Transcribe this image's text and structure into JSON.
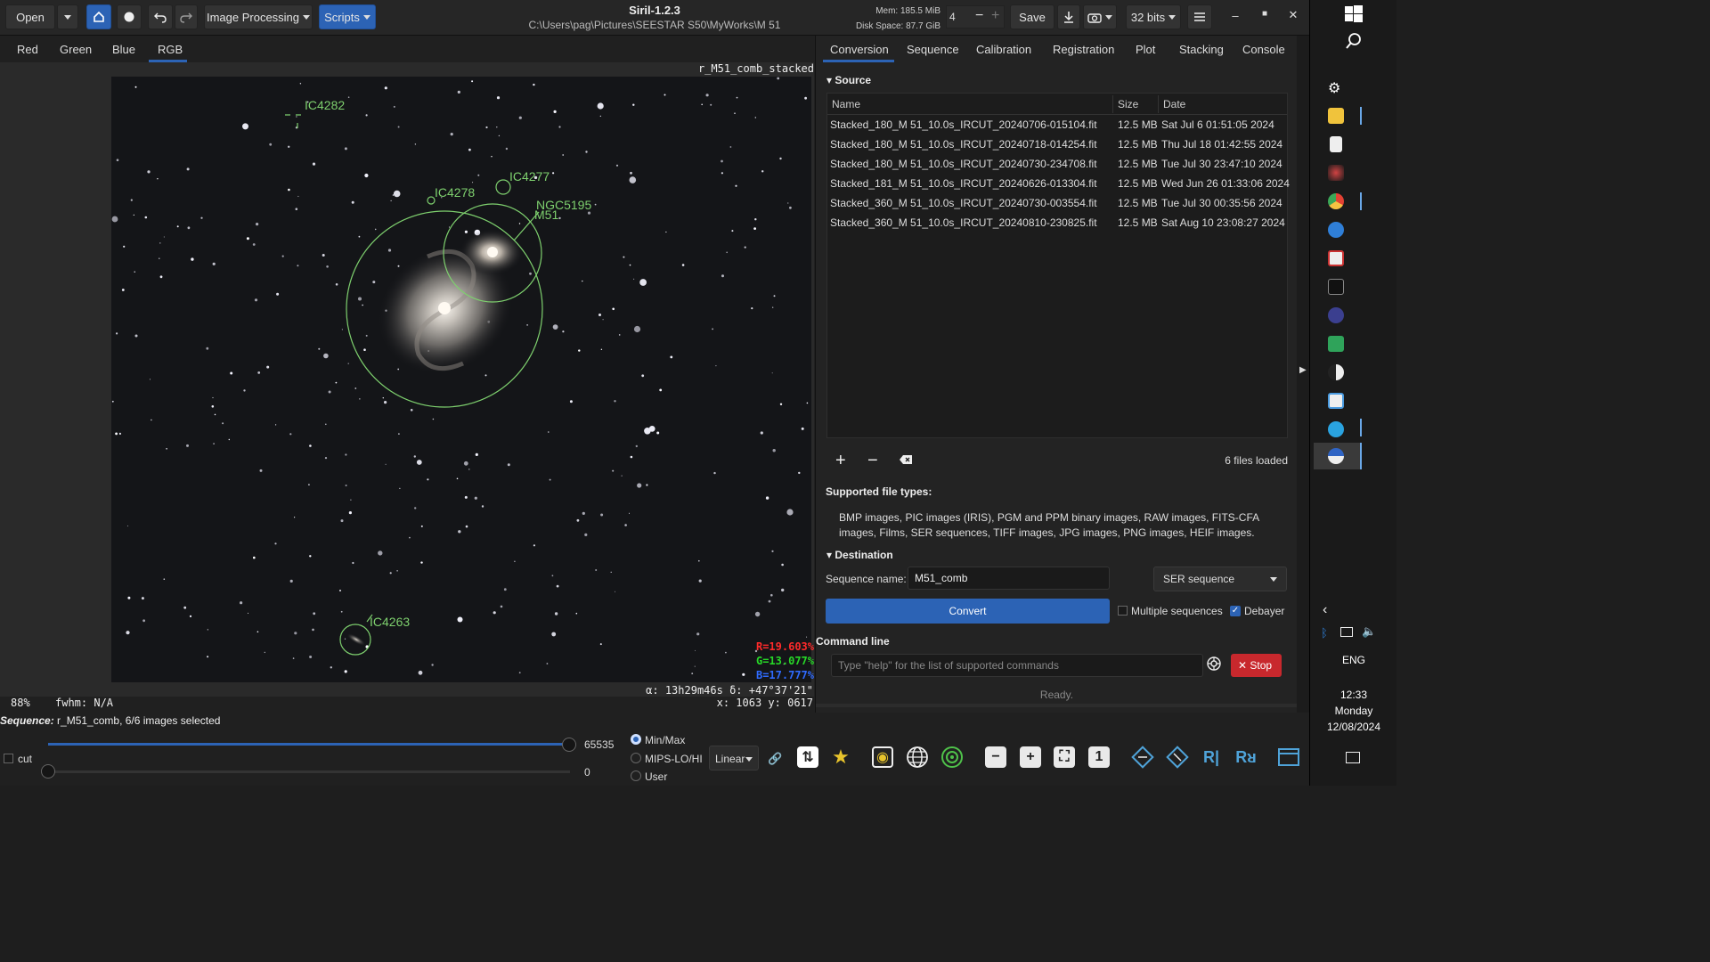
{
  "window": {
    "app_title": "Siril-1.2.3",
    "path": "C:\\Users\\pag\\Pictures\\SEESTAR S50\\MyWorks\\M 51",
    "mem": "Mem: 185.5 MiB",
    "disk": "Disk Space: 87.7 GiB",
    "threads": "4",
    "open_label": "Open",
    "image_processing_label": "Image Processing",
    "scripts_label": "Scripts",
    "save_label": "Save",
    "bits_label": "32 bits"
  },
  "view_tabs": [
    "Red",
    "Green",
    "Blue",
    "RGB"
  ],
  "active_view_tab": "RGB",
  "image": {
    "name": "r_M51_comb_stacked",
    "annotations": [
      "IC4282",
      "IC4277",
      "IC4278",
      "NGC5195",
      "M51",
      "IC4263"
    ],
    "r_value": "R=19.603%",
    "g_value": "G=13.077%",
    "b_value": "B=17.777%",
    "zoom": "88%",
    "fwhm": "fwhm: N/A",
    "coords": "α: 13h29m46s δ: +47°37'21\"",
    "xy": "x: 1063 y: 0617"
  },
  "right_tabs": [
    "Conversion",
    "Sequence",
    "Calibration",
    "Registration",
    "Plot",
    "Stacking",
    "Console"
  ],
  "active_right_tab": "Conversion",
  "source": {
    "header": "Source",
    "columns": {
      "name": "Name",
      "size": "Size",
      "date": "Date"
    },
    "files": [
      {
        "name": "Stacked_180_M 51_10.0s_IRCUT_20240706-015104.fit",
        "size": "12.5 MB",
        "date": "Sat Jul  6 01:51:05 2024"
      },
      {
        "name": "Stacked_180_M 51_10.0s_IRCUT_20240718-014254.fit",
        "size": "12.5 MB",
        "date": "Thu Jul 18 01:42:55 2024"
      },
      {
        "name": "Stacked_180_M 51_10.0s_IRCUT_20240730-234708.fit",
        "size": "12.5 MB",
        "date": "Tue Jul 30 23:47:10 2024"
      },
      {
        "name": "Stacked_181_M 51_10.0s_IRCUT_20240626-013304.fit",
        "size": "12.5 MB",
        "date": "Wed Jun 26 01:33:06 2024"
      },
      {
        "name": "Stacked_360_M 51_10.0s_IRCUT_20240730-003554.fit",
        "size": "12.5 MB",
        "date": "Tue Jul 30 00:35:56 2024"
      },
      {
        "name": "Stacked_360_M 51_10.0s_IRCUT_20240810-230825.fit",
        "size": "12.5 MB",
        "date": "Sat Aug 10 23:08:27 2024"
      }
    ],
    "files_loaded": "6 files loaded",
    "supported_title": "Supported file types:",
    "supported_text": "BMP images, PIC images (IRIS), PGM and PPM binary images, RAW images, FITS-CFA images, Films, SER sequences, TIFF images, JPG images, PNG images, HEIF images."
  },
  "destination": {
    "header": "Destination",
    "sequence_label": "Sequence name:",
    "sequence_value": "M51_comb",
    "format": "SER sequence",
    "convert_label": "Convert",
    "multiple_label": "Multiple sequences",
    "multiple_checked": false,
    "debayer_label": "Debayer",
    "debayer_checked": true
  },
  "command": {
    "header": "Command line",
    "placeholder": "Type \"help\" for the list of supported commands",
    "stop_label": "Stop",
    "status": "Ready."
  },
  "bottom": {
    "sequence_label": "Sequence:",
    "sequence_text": "r_M51_comb, 6/6 images selected",
    "cut_label": "cut",
    "high_value": "65535",
    "low_value": "0",
    "radio_minmax": "Min/Max",
    "radio_mips": "MIPS-LO/HI",
    "radio_user": "User",
    "stretch": "Linear",
    "high_slider_level": 1.0,
    "low_slider_level": 0.0
  },
  "taskbar": {
    "lang": "ENG",
    "time": "12:33",
    "day": "Monday",
    "date": "12/08/2024"
  },
  "colors": {
    "accent": "#2c63b5",
    "annotation": "#7ed06e",
    "stop": "#c8282d",
    "r": "#ff2a2a",
    "g": "#27d827",
    "b": "#2f6bff"
  }
}
